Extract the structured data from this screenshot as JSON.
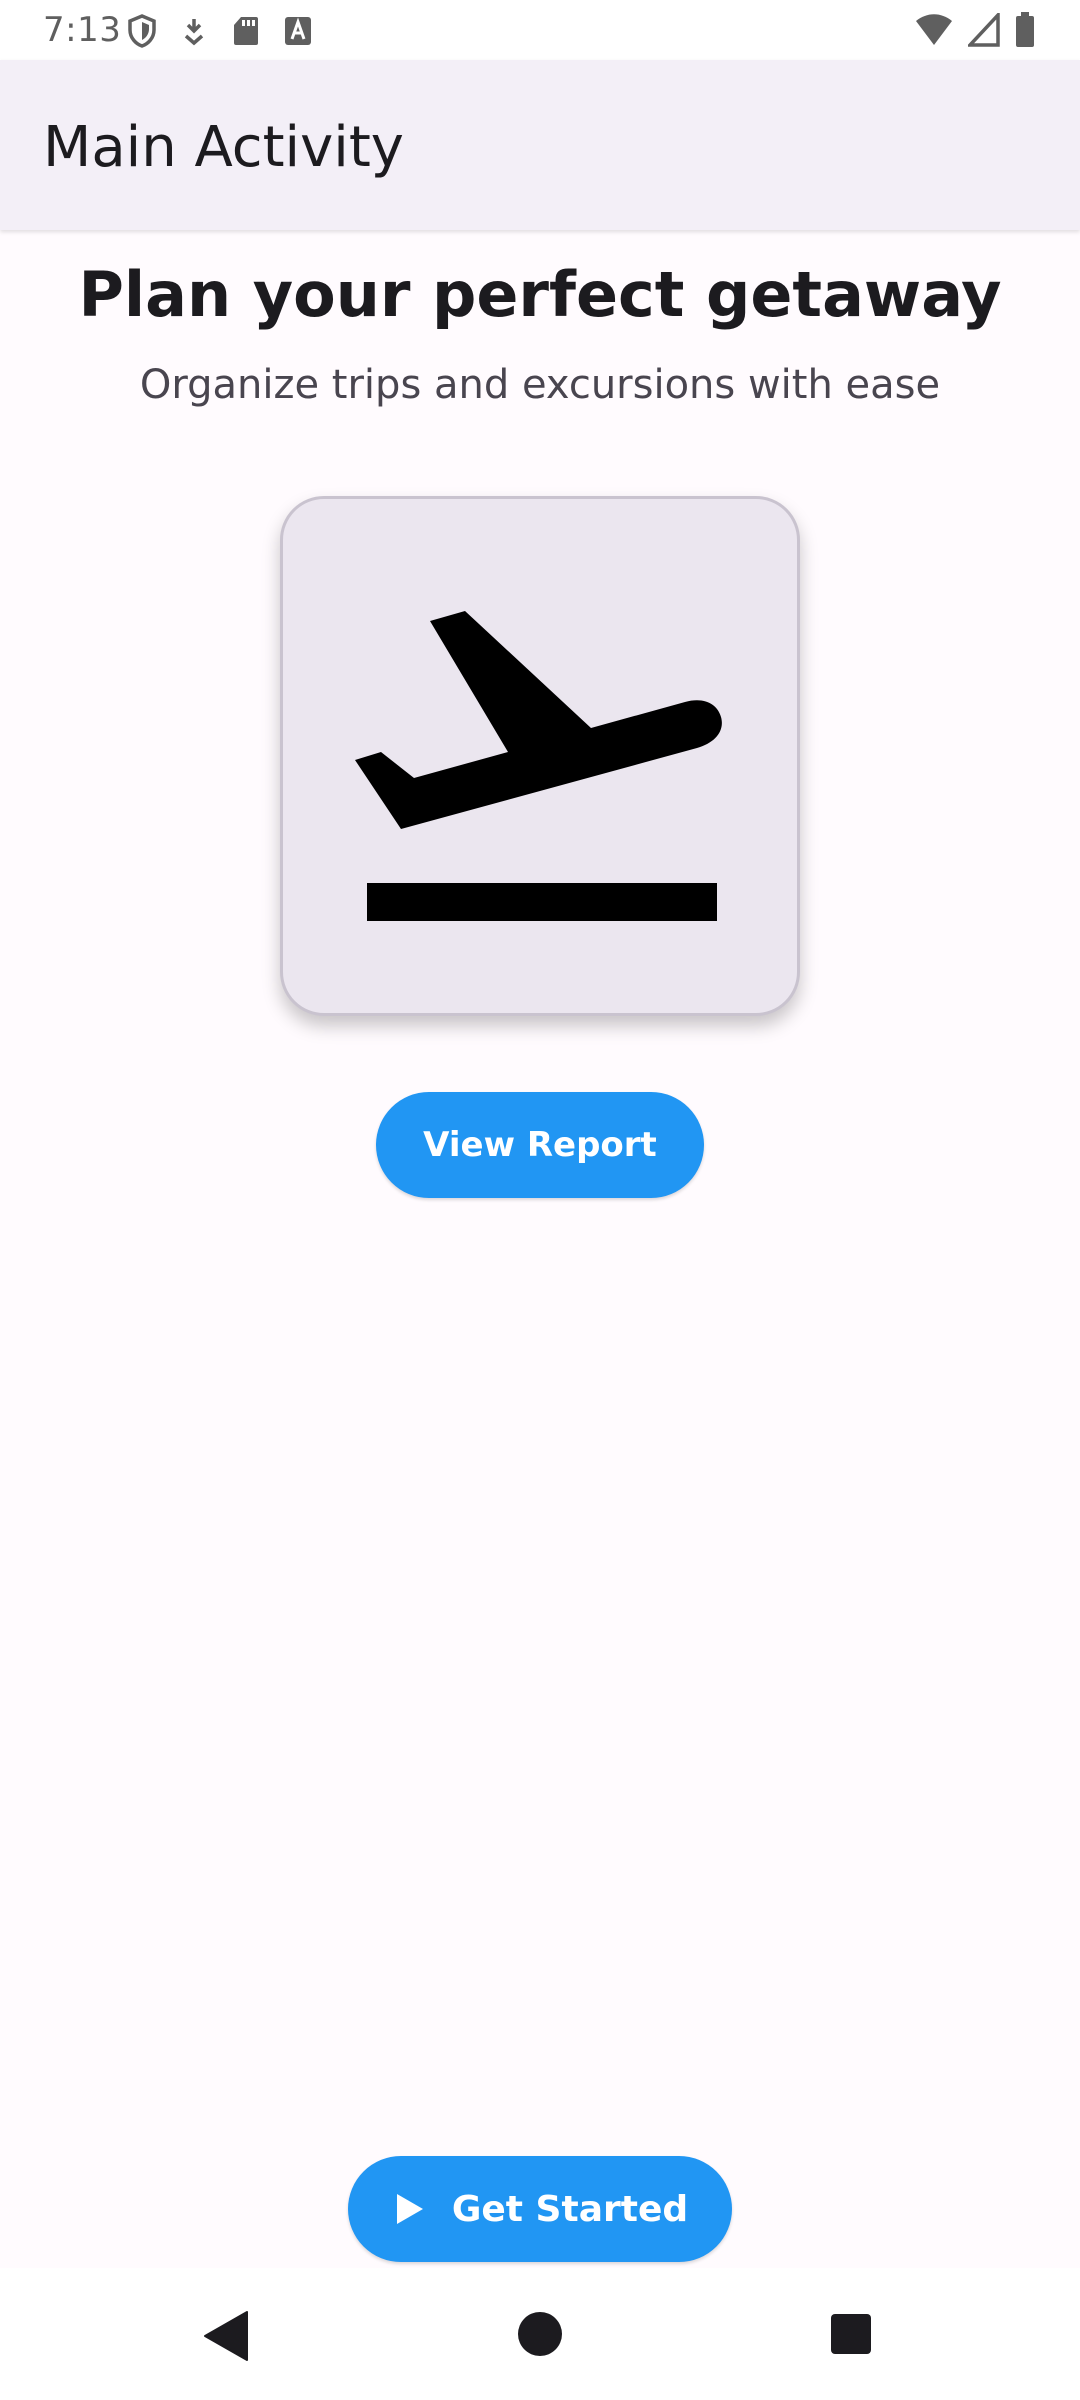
{
  "status_bar": {
    "time": "7:13",
    "icons_left": [
      "shield-icon",
      "download-icon",
      "sd-card-icon",
      "font-a-icon"
    ],
    "icons_right": [
      "wifi-icon",
      "cellular-signal-icon",
      "battery-icon"
    ]
  },
  "app_bar": {
    "title": "Main Activity"
  },
  "hero": {
    "headline": "Plan your perfect getaway",
    "subheadline": "Organize trips and excursions with ease",
    "icon": "flight-takeoff-icon"
  },
  "actions": {
    "view_report_label": "View Report",
    "get_started_label": "Get Started",
    "get_started_icon": "play-icon"
  },
  "colors": {
    "accent": "#2196f3",
    "background": "#fffbfe",
    "app_bar": "#f3eff7",
    "card": "#ebe6ef"
  },
  "nav_bar": {
    "buttons": [
      "back-icon",
      "home-icon",
      "recents-icon"
    ]
  }
}
